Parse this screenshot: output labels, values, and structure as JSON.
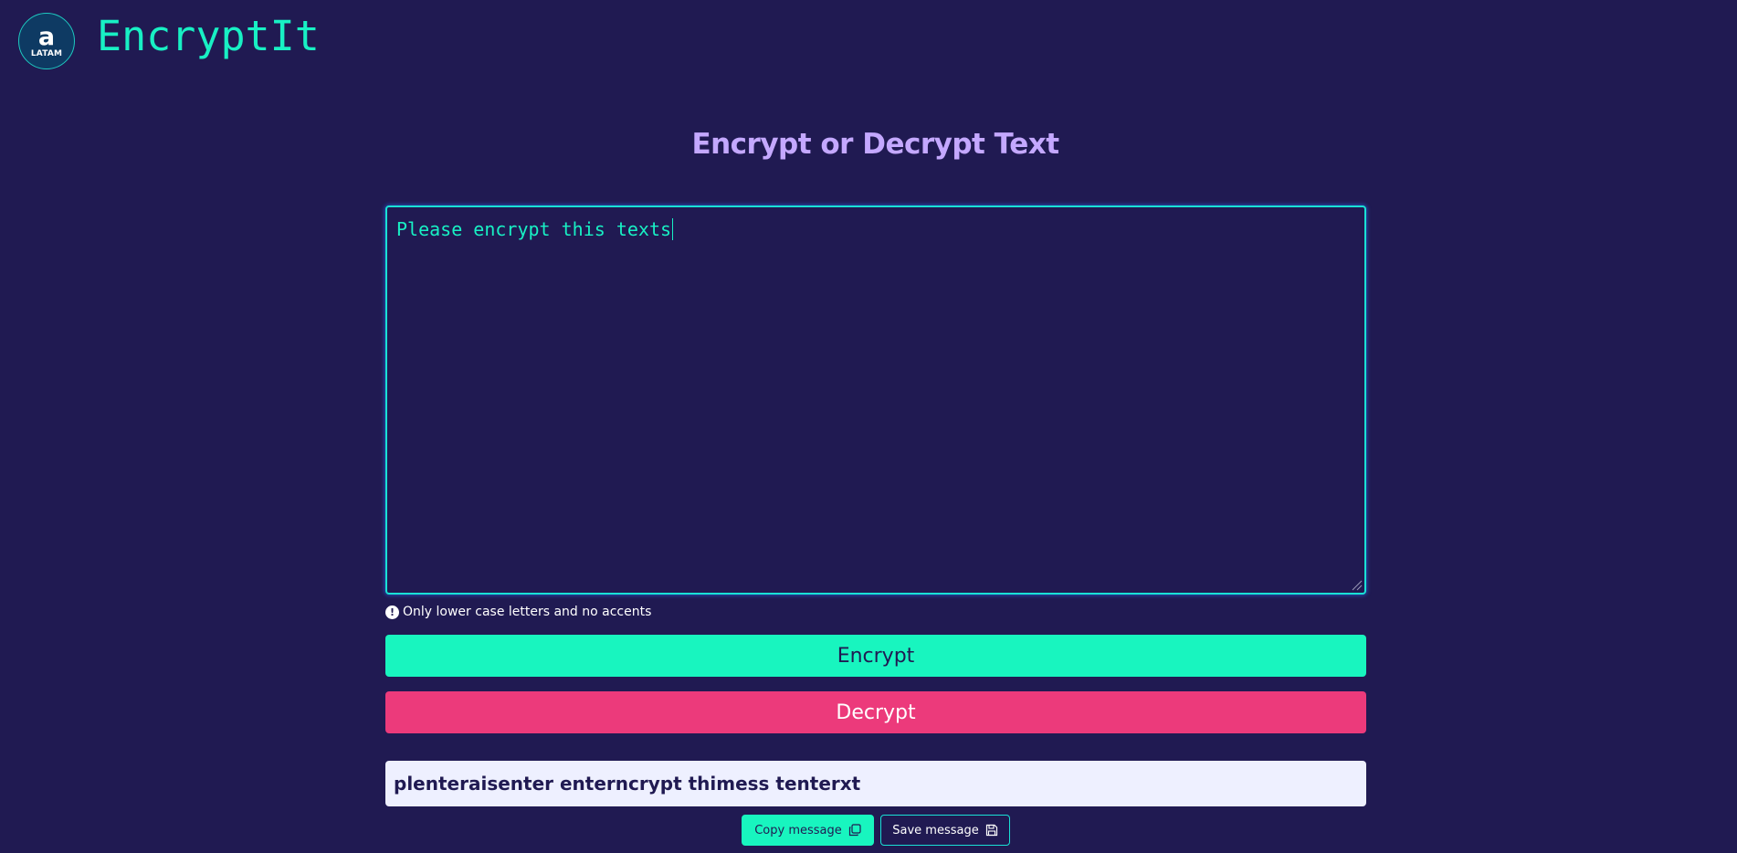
{
  "header": {
    "logo_glyph": "a",
    "logo_subtext": "LATAM",
    "app_name": "EncryptIt"
  },
  "main": {
    "title": "Encrypt or Decrypt Text",
    "input_text": "Please encrypt this texts",
    "hint_icon": "!",
    "hint": "Only lower case letters and no accents",
    "encrypt_label": "Encrypt",
    "decrypt_label": "Decrypt",
    "output_text": "plenteraisenter enterncrypt thimess tenterxt",
    "copy_label": "Copy message",
    "save_label": "Save message"
  },
  "colors": {
    "background": "#201a52",
    "accent": "#18f5bf",
    "decrypt": "#ec3a7b",
    "title": "#c4a8ff"
  }
}
